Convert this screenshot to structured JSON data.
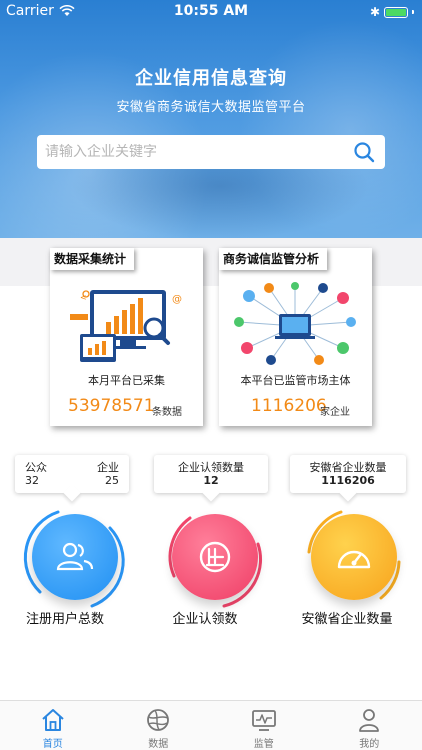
{
  "status_bar": {
    "carrier": "Carrier",
    "time": "10:55 AM"
  },
  "header": {
    "title": "企业信用信息查询",
    "subtitle": "安徽省商务诚信大数据监管平台"
  },
  "search": {
    "placeholder": "请输入企业关键字"
  },
  "cards": [
    {
      "tag": "数据采集统计",
      "caption": "本月平台已采集",
      "value": "53978571",
      "unit": "条数据"
    },
    {
      "tag": "商务诚信监管分析",
      "caption": "本平台已监管市场主体",
      "value": "1116206",
      "unit": "家企业"
    }
  ],
  "bubbles": {
    "users": {
      "label_a": "公众",
      "label_b": "企业",
      "value_a": "32",
      "value_b": "25"
    },
    "claimed": {
      "label": "企业认领数量",
      "value": "12"
    },
    "province": {
      "label": "安徽省企业数量",
      "value": "1116206"
    }
  },
  "stats": [
    {
      "label": "注册用户总数",
      "color": "#2a96f6"
    },
    {
      "label": "企业认领数",
      "color": "#f2466c"
    },
    {
      "label": "安徽省企业数量",
      "color": "#f9ae22"
    }
  ],
  "tabs": [
    {
      "label": "首页",
      "icon": "home-icon",
      "active": true
    },
    {
      "label": "数据",
      "icon": "globe-icon",
      "active": false
    },
    {
      "label": "监管",
      "icon": "monitor-icon",
      "active": false
    },
    {
      "label": "我的",
      "icon": "user-icon",
      "active": false
    }
  ],
  "colors": {
    "accent": "#2a86e0",
    "number_orange": "#f28a17"
  }
}
